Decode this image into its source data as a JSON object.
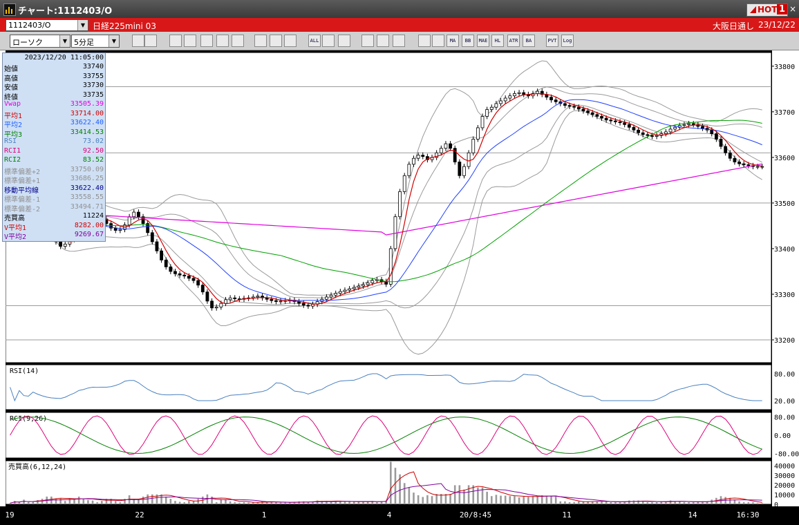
{
  "window": {
    "title": "チャート:1112403/O",
    "hot_label": "HOT",
    "hot_number": "1",
    "close": "×"
  },
  "symbol": {
    "code": "1112403/O",
    "instrument": "日経225mini 03",
    "session": "大阪日通し",
    "date": "23/12/22"
  },
  "toolbar": {
    "chart_type": "ローソク",
    "interval": "5分足",
    "buttons": [
      "zoom",
      "crosshair",
      "candle-a",
      "candle-b",
      "candle-c",
      "fib",
      "line",
      "rect",
      "mark-a",
      "mark-b",
      "all",
      "pen",
      "cursor",
      "arrow",
      "settings",
      "tool",
      "palette",
      "vol",
      "ma",
      "bb",
      "mae",
      "hl",
      "atr",
      "ba",
      "pvt",
      "log",
      "sync"
    ],
    "button_texts": {
      "all": "ALL",
      "ma": "MA",
      "bb": "BB",
      "mae": "MAE",
      "hl": "HL",
      "atr": "ATR",
      "ba": "BA",
      "pvt": "PVT",
      "log": "Log"
    }
  },
  "data_window": {
    "timestamp": "2023/12/20 11:05:00",
    "rows": [
      {
        "label": "始値",
        "value": "33740",
        "color": "#000000"
      },
      {
        "label": "高値",
        "value": "33755",
        "color": "#000000"
      },
      {
        "label": "安値",
        "value": "33730",
        "color": "#000000"
      },
      {
        "label": "終値",
        "value": "33735",
        "color": "#000000"
      },
      {
        "label": "Vwap",
        "value": "33505.39",
        "color": "#e000e0"
      },
      {
        "label": "平均1",
        "value": "33714.00",
        "color": "#d00000"
      },
      {
        "label": "平均2",
        "value": "33622.40",
        "color": "#2060ff"
      },
      {
        "label": "平均3",
        "value": "33414.53",
        "color": "#008000"
      },
      {
        "label": "RSI",
        "value": "73.02",
        "color": "#4a80c0"
      },
      {
        "label": "RCI1",
        "value": "92.50",
        "color": "#e0007a"
      },
      {
        "label": "RCI2",
        "value": "83.52",
        "color": "#008000"
      },
      {
        "label": "標準偏差+2",
        "value": "33750.09",
        "color": "#909090"
      },
      {
        "label": "標準偏差+1",
        "value": "33686.25",
        "color": "#909090"
      },
      {
        "label": "移動平均線",
        "value": "33622.40",
        "color": "#00008b"
      },
      {
        "label": "標準偏差-1",
        "value": "33558.55",
        "color": "#909090"
      },
      {
        "label": "標準偏差-2",
        "value": "33494.71",
        "color": "#909090"
      },
      {
        "label": "売買高",
        "value": "11224",
        "color": "#000000"
      },
      {
        "label": "V平均1",
        "value": "8282.00",
        "color": "#d00000"
      },
      {
        "label": "V平均2",
        "value": "9269.67",
        "color": "#8000a0"
      }
    ]
  },
  "chart_data": [
    {
      "type": "candlestick",
      "name": "price",
      "ylim": [
        33150,
        33830
      ],
      "y_ticks": [
        33200,
        33300,
        33400,
        33500,
        33600,
        33700,
        33800
      ],
      "x_ticks": [
        "19",
        "22",
        "1",
        "4",
        "20/8:45",
        "11",
        "14",
        "16:30"
      ],
      "horizontal_lines": [
        33200,
        33275,
        33500,
        33610,
        33755
      ],
      "closes": [
        33480,
        33475,
        33478,
        33470,
        33468,
        33472,
        33465,
        33455,
        33440,
        33425,
        33415,
        33405,
        33410,
        33420,
        33430,
        33445,
        33455,
        33462,
        33468,
        33470,
        33465,
        33455,
        33445,
        33440,
        33442,
        33452,
        33470,
        33480,
        33470,
        33455,
        33435,
        33415,
        33395,
        33375,
        33360,
        33350,
        33345,
        33342,
        33340,
        33335,
        33330,
        33320,
        33305,
        33285,
        33270,
        33272,
        33280,
        33288,
        33292,
        33290,
        33289,
        33291,
        33292,
        33294,
        33296,
        33292,
        33289,
        33286,
        33284,
        33285,
        33286,
        33287,
        33284,
        33280,
        33276,
        33274,
        33278,
        33284,
        33289,
        33294,
        33298,
        33302,
        33306,
        33309,
        33312,
        33315,
        33318,
        33321,
        33325,
        33330,
        33332,
        33328,
        33322,
        33400,
        33470,
        33525,
        33560,
        33585,
        33598,
        33605,
        33602,
        33595,
        33600,
        33610,
        33620,
        33630,
        33620,
        33590,
        33560,
        33580,
        33610,
        33640,
        33665,
        33690,
        33705,
        33710,
        33718,
        33724,
        33730,
        33735,
        33740,
        33742,
        33738,
        33735,
        33740,
        33745,
        33738,
        33732,
        33726,
        33722,
        33718,
        33714,
        33712,
        33710,
        33706,
        33702,
        33698,
        33694,
        33690,
        33686,
        33682,
        33680,
        33678,
        33676,
        33672,
        33666,
        33660,
        33654,
        33650,
        33648,
        33646,
        33648,
        33652,
        33656,
        33662,
        33666,
        33670,
        33672,
        33674,
        33672,
        33668,
        33664,
        33660,
        33652,
        33640,
        33624,
        33610,
        33598,
        33590,
        33586,
        33584,
        33582,
        33580,
        33580,
        33580
      ],
      "series": [
        {
          "name": "平均1",
          "color": "#d00000"
        },
        {
          "name": "平均2",
          "color": "#2040ff"
        },
        {
          "name": "平均3",
          "color": "#00a000"
        },
        {
          "name": "Vwap",
          "color": "#e000e0"
        },
        {
          "name": "標準偏差+2",
          "color": "#909090"
        },
        {
          "name": "標準偏差+1",
          "color": "#909090"
        },
        {
          "name": "標準偏差-1",
          "color": "#909090"
        },
        {
          "name": "標準偏差-2",
          "color": "#909090"
        }
      ]
    },
    {
      "type": "line",
      "name": "rsi",
      "title": "RSI(14)",
      "ylim": [
        0,
        100
      ],
      "y_ticks": [
        "80.00",
        "20.00"
      ],
      "series": [
        {
          "name": "RSI",
          "color": "#4a80c0"
        }
      ]
    },
    {
      "type": "line",
      "name": "rci",
      "title": "RCI(9,26)",
      "ylim": [
        -100,
        100
      ],
      "y_ticks": [
        "80.00",
        "0.00",
        "-80.00"
      ],
      "series": [
        {
          "name": "RCI1",
          "color": "#e0007a"
        },
        {
          "name": "RCI2",
          "color": "#008000"
        }
      ]
    },
    {
      "type": "bar",
      "name": "volume",
      "title": "売買高(6,12,24)",
      "ylim": [
        0,
        45000
      ],
      "y_ticks": [
        "40000",
        "30000",
        "20000",
        "10000",
        "0"
      ],
      "series": [
        {
          "name": "V平均1",
          "color": "#d00000"
        },
        {
          "name": "V平均2",
          "color": "#8000a0"
        }
      ]
    }
  ]
}
